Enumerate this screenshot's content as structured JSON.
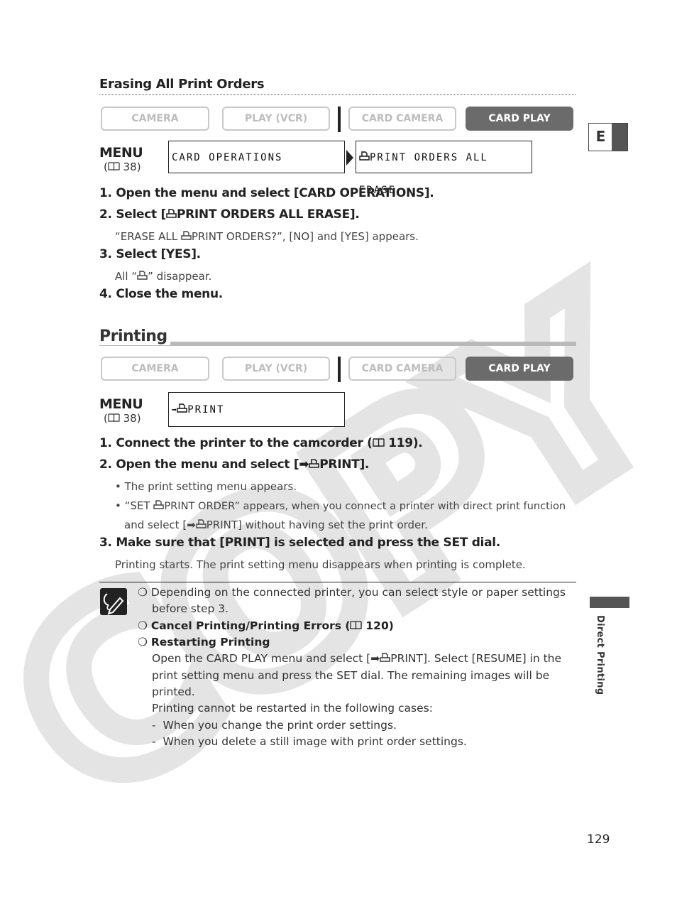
{
  "section1": {
    "title": "Erasing All Print Orders",
    "modes": [
      {
        "label": "CAMERA",
        "active": false
      },
      {
        "label": "PLAY (VCR)",
        "active": false
      },
      {
        "label": "CARD CAMERA",
        "active": false
      },
      {
        "label": "CARD PLAY",
        "active": true
      }
    ],
    "menu": {
      "label": "MENU",
      "ref": "38",
      "box1": "CARD OPERATIONS",
      "box2": "PRINT ORDERS ALL ERASE"
    },
    "steps": [
      {
        "num": "1.",
        "text": "Open the menu and select [CARD OPERATIONS]."
      },
      {
        "num": "2.",
        "pre": "Select [",
        "text": "PRINT ORDERS ALL ERASE]."
      },
      {
        "num": "3.",
        "text": "Select [YES]."
      },
      {
        "num": "4.",
        "text": "Close the menu."
      }
    ],
    "sub2_pre": "“ERASE ALL ",
    "sub2_post": "PRINT ORDERS?”, [NO] and [YES] appears.",
    "sub3_pre": "All “",
    "sub3_post": "” disappear."
  },
  "section2": {
    "title": "Printing",
    "modes": [
      {
        "label": "CAMERA",
        "active": false
      },
      {
        "label": "PLAY (VCR)",
        "active": false
      },
      {
        "label": "CARD CAMERA",
        "active": false
      },
      {
        "label": "CARD PLAY",
        "active": true
      }
    ],
    "menu": {
      "label": "MENU",
      "ref": "38",
      "box1": "PRINT"
    },
    "step1_text": "Connect the printer to the camcorder (",
    "step1_ref": "119).",
    "step2_text": "Open the menu and select [",
    "step2_post": "PRINT].",
    "bullet1": "The print setting menu appears.",
    "bullet2_pre": "“SET ",
    "bullet2_mid": "PRINT ORDER” appears, when you connect a printer with direct print function",
    "bullet2_line2_pre": "and select [",
    "bullet2_line2_post": "PRINT] without having set the print order.",
    "step3_text": "Make sure that [PRINT] is selected and press the SET dial.",
    "step3_sub": "Printing starts. The print setting menu disappears when printing is complete."
  },
  "notes": {
    "n1_line1": "Depending on the connected printer, you can select style or paper settings",
    "n1_line2": "before step 3.",
    "n2_pre": "Cancel Printing/Printing Errors (",
    "n2_ref": "120)",
    "n3_title": "Restarting Printing",
    "n3_l1_pre": "Open the CARD PLAY menu and select [",
    "n3_l1_post": "PRINT]. Select [RESUME] in the",
    "n3_l2": "print setting menu and press the SET dial. The remaining images will be",
    "n3_l3": "printed.",
    "n3_l4": "Printing cannot be restarted in the following cases:",
    "n3_d1": "When you change the print order settings.",
    "n3_d2": "When you delete a still image with print order settings."
  },
  "side": {
    "tab_letter": "E",
    "chapter": "Direct Printing"
  },
  "page_number": "129",
  "watermark": "COPY"
}
